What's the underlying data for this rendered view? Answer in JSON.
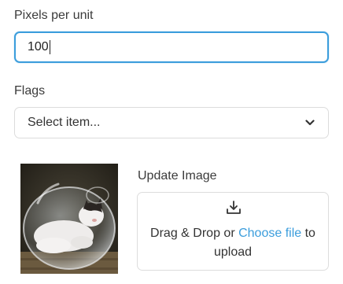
{
  "fields": {
    "pixels_per_unit": {
      "label": "Pixels per unit",
      "value": "100"
    },
    "flags": {
      "label": "Flags",
      "selected": "Select item..."
    }
  },
  "image_upload": {
    "label": "Update Image",
    "drop_text_before": "Drag & Drop or",
    "choose_file_link": "Choose file",
    "drop_text_after": "to upload"
  },
  "icons": {
    "select_chevron": "chevron-down-icon",
    "upload": "download-tray-icon"
  },
  "colors": {
    "accent": "#3b9ddc",
    "border": "#dddddd",
    "text": "#333333"
  }
}
